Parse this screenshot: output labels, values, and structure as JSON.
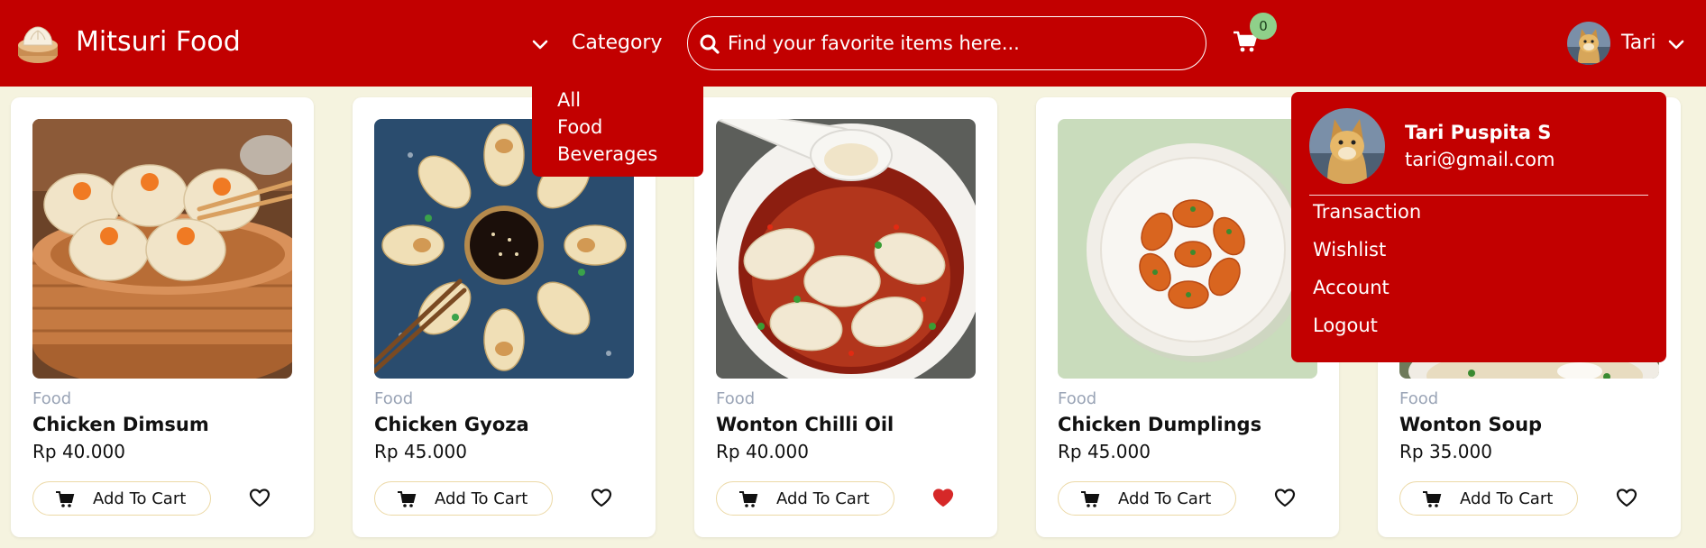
{
  "navbar": {
    "brand": "Mitsuri Food",
    "category_label": "Category",
    "search_placeholder": "Find your favorite items here...",
    "cart_count": "0",
    "user_name": "Tari",
    "bg_color": "#c20000"
  },
  "category_menu": {
    "items": [
      {
        "label": "All"
      },
      {
        "label": "Food"
      },
      {
        "label": "Beverages"
      }
    ]
  },
  "user_menu": {
    "full_name": "Tari Puspita S",
    "email": "tari@gmail.com",
    "items": [
      {
        "label": "Transaction"
      },
      {
        "label": "Wishlist"
      },
      {
        "label": "Account"
      },
      {
        "label": "Logout"
      }
    ]
  },
  "products": [
    {
      "category": "Food",
      "name": "Chicken Dimsum",
      "price": "Rp 40.000",
      "button": "Add To Cart",
      "wishlisted": false
    },
    {
      "category": "Food",
      "name": "Chicken Gyoza",
      "price": "Rp 45.000",
      "button": "Add To Cart",
      "wishlisted": false
    },
    {
      "category": "Food",
      "name": "Wonton Chilli Oil",
      "price": "Rp 40.000",
      "button": "Add To Cart",
      "wishlisted": true
    },
    {
      "category": "Food",
      "name": "Chicken Dumplings",
      "price": "Rp 45.000",
      "button": "Add To Cart",
      "wishlisted": false
    },
    {
      "category": "Food",
      "name": "Wonton Soup",
      "price": "Rp 35.000",
      "button": "Add To Cart",
      "wishlisted": false
    }
  ],
  "colors": {
    "primary": "#c20000",
    "page_background": "#f5f3df",
    "badge": "#8fd08a",
    "heart_active": "#d62828"
  }
}
